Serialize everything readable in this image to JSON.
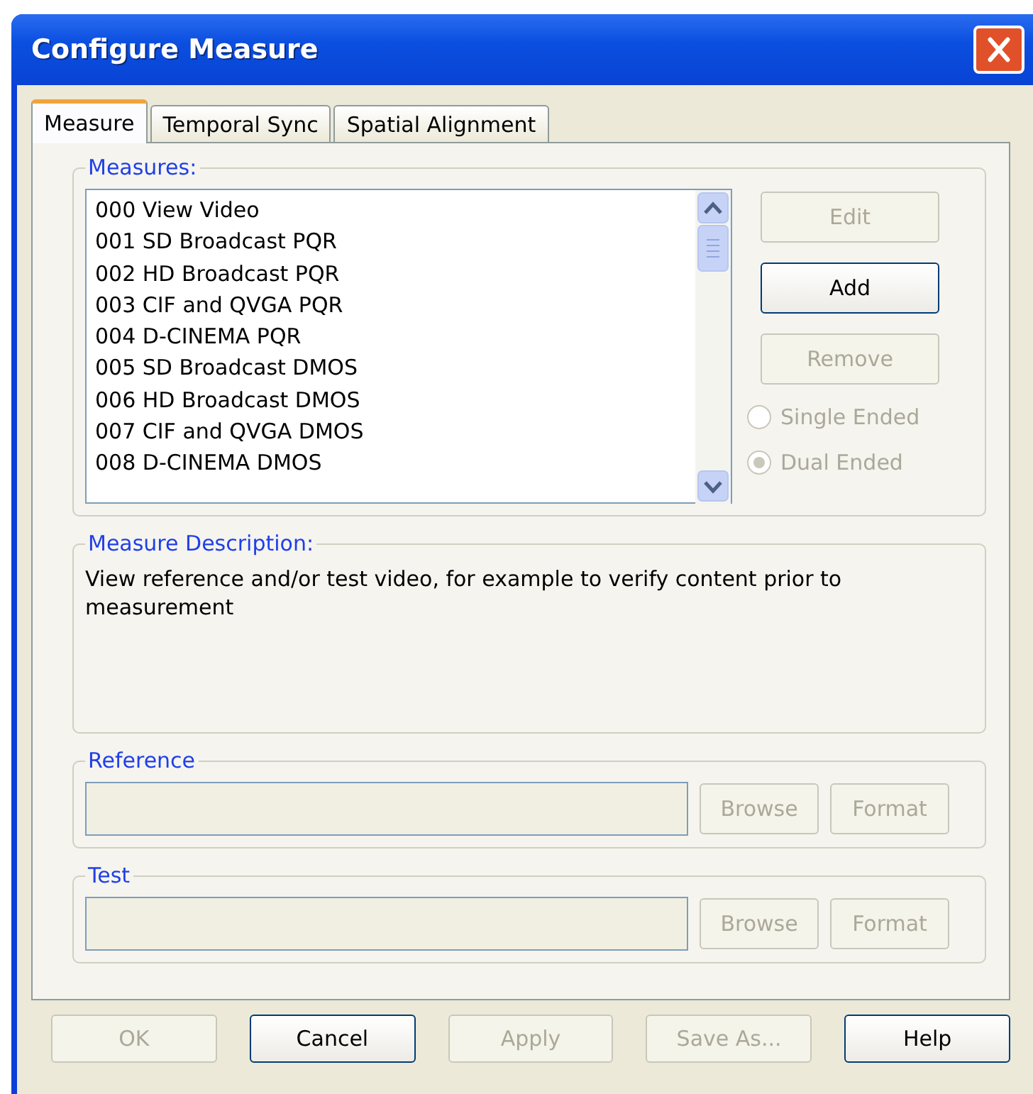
{
  "window": {
    "title": "Configure Measure"
  },
  "tabs": [
    {
      "label": "Measure",
      "selected": true
    },
    {
      "label": "Temporal Sync",
      "selected": false
    },
    {
      "label": "Spatial Alignment",
      "selected": false
    }
  ],
  "measures": {
    "label": "Measures:",
    "items": [
      "000 View Video",
      "001 SD Broadcast PQR",
      "002 HD Broadcast PQR",
      "003 CIF and QVGA PQR",
      "004 D-CINEMA PQR",
      "005 SD Broadcast DMOS",
      "006 HD Broadcast DMOS",
      "007 CIF and QVGA DMOS",
      "008 D-CINEMA DMOS"
    ],
    "buttons": [
      {
        "label": "Edit",
        "disabled": true
      },
      {
        "label": "Add",
        "disabled": false
      },
      {
        "label": "Remove",
        "disabled": true
      }
    ],
    "modes": [
      {
        "label": "Single Ended",
        "selected": false,
        "disabled": true
      },
      {
        "label": "Dual Ended",
        "selected": true,
        "disabled": true
      }
    ]
  },
  "description": {
    "label": "Measure Description:",
    "text": "View reference and/or test video, for example to verify content prior to measurement"
  },
  "files": [
    {
      "label": "Reference",
      "buttons": [
        {
          "label": "Browse",
          "disabled": true
        },
        {
          "label": "Format",
          "disabled": true
        }
      ]
    },
    {
      "label": "Test",
      "buttons": [
        {
          "label": "Browse",
          "disabled": true
        },
        {
          "label": "Format",
          "disabled": true
        }
      ]
    }
  ],
  "buttons": [
    {
      "label": "OK",
      "disabled": true
    },
    {
      "label": "Cancel",
      "disabled": false
    },
    {
      "label": "Apply",
      "disabled": true
    },
    {
      "label": "Save As...",
      "disabled": true
    },
    {
      "label": "Help",
      "disabled": false
    }
  ]
}
